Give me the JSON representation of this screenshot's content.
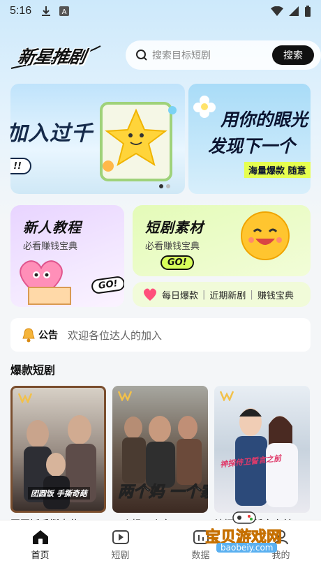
{
  "status_bar": {
    "time": "5:16"
  },
  "header": {
    "logo_text": "新星推剧",
    "search_placeholder": "搜索目标短剧",
    "search_button": "搜索"
  },
  "banner": {
    "slide1_text": "加入过千",
    "slide1_pill": "!!",
    "slide2_line1": "用你的眼光",
    "slide2_line2": "发现下一个",
    "slide2_tag": "海量爆款 随意"
  },
  "cards": {
    "tutorial": {
      "title": "新人教程",
      "subtitle": "必看赚钱宝典",
      "go": "GO!"
    },
    "material": {
      "title": "短剧素材",
      "subtitle": "必看赚钱宝典",
      "go": "GO!"
    },
    "links": [
      "每日爆款",
      "近期新剧",
      "赚钱宝典"
    ]
  },
  "notice": {
    "label": "公告",
    "text": "欢迎各位达人的加入"
  },
  "section": {
    "title": "爆款短剧"
  },
  "dramas": [
    {
      "title": "团圆饭手撕奇葩",
      "poster_text": "团圆饭 手撕奇葩"
    },
    {
      "title": "两个妈一个家",
      "poster_text": "两个妈 一个家"
    },
    {
      "title": "神探侍卫誓言之前",
      "poster_text": "神探侍卫誓言之前"
    }
  ],
  "nav": [
    {
      "label": "首页",
      "icon": "home-icon",
      "active": true
    },
    {
      "label": "短剧",
      "icon": "play-icon",
      "active": false
    },
    {
      "label": "数据",
      "icon": "chart-icon",
      "active": false
    },
    {
      "label": "我的",
      "icon": "user-icon",
      "active": false
    }
  ],
  "watermark": {
    "text": "宝贝游戏网",
    "url": "baobeiy.com"
  },
  "colors": {
    "accent": "#111111",
    "go_badge": "#ffffff",
    "tag_yellow": "#e6ff4f"
  }
}
